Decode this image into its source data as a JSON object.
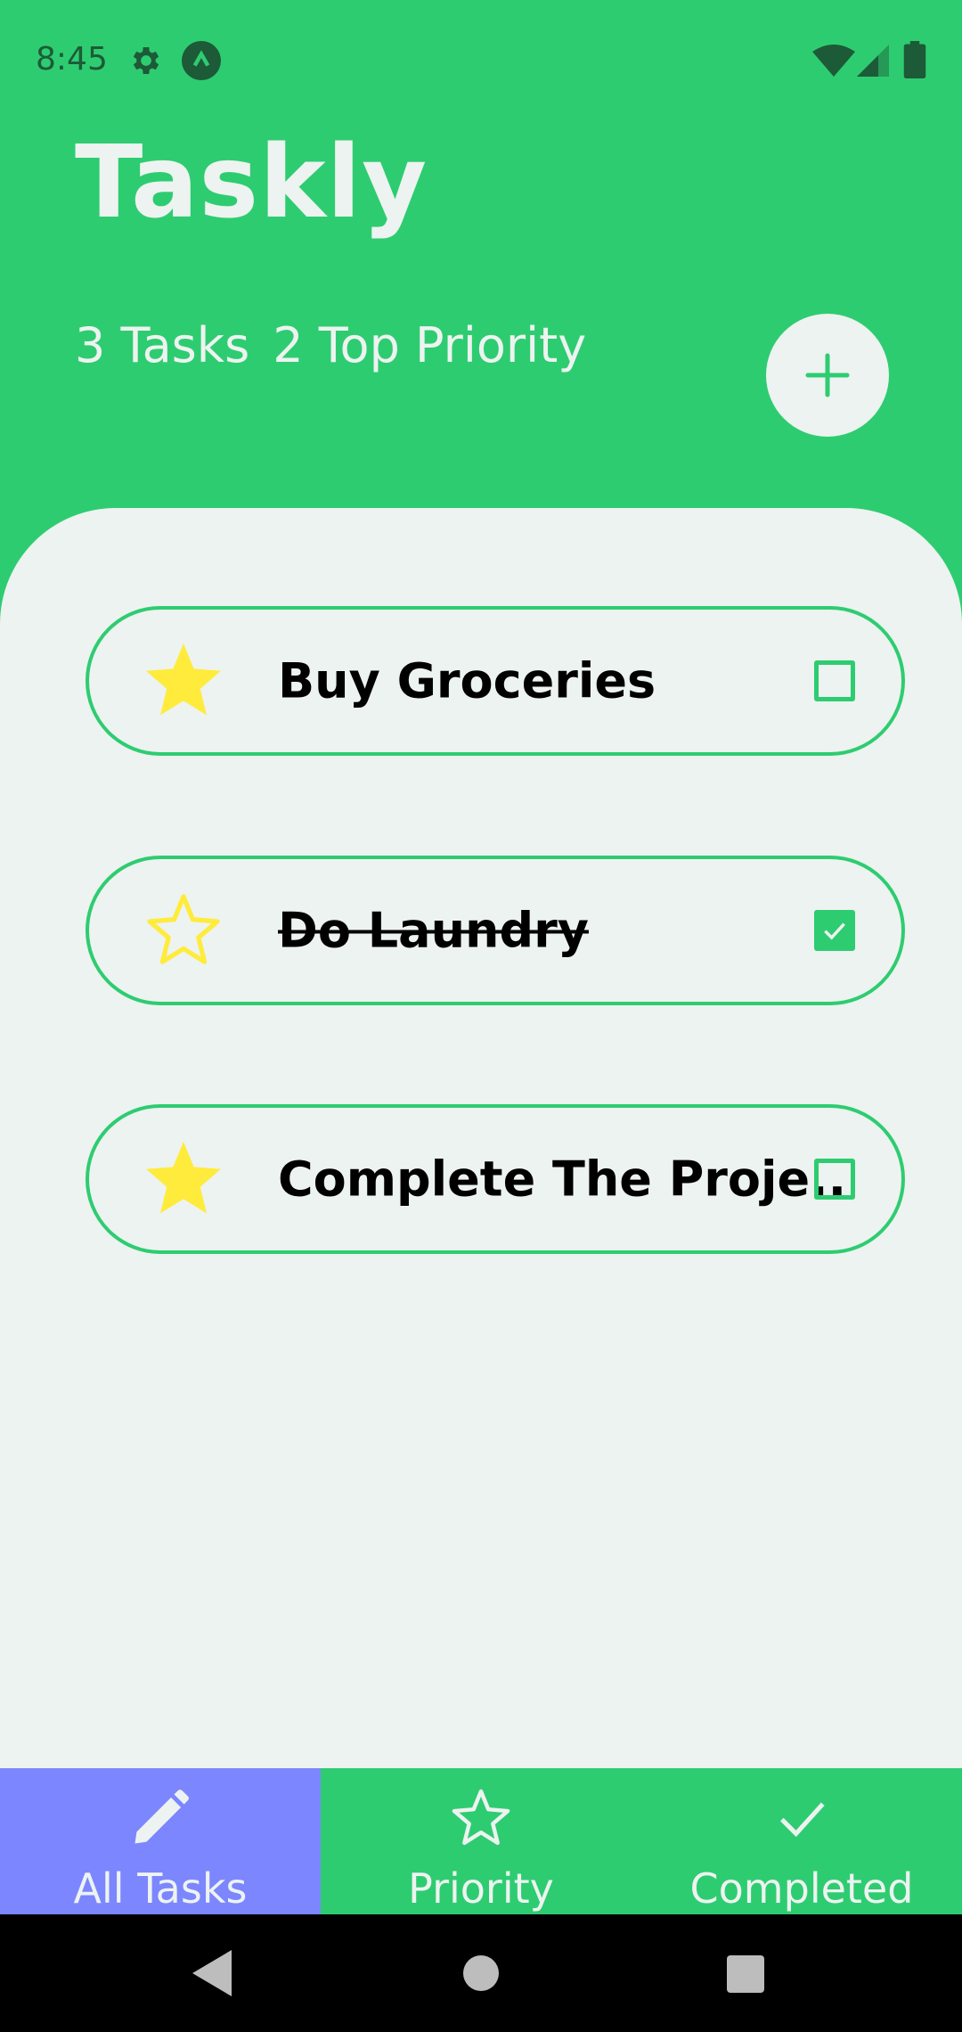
{
  "status_bar": {
    "time": "8:45",
    "icons": [
      "gear-icon",
      "app-notification-icon",
      "wifi-icon",
      "signal-icon",
      "battery-icon"
    ]
  },
  "header": {
    "title": "Taskly",
    "task_count": "3 Tasks",
    "priority_count": "2 Top Priority",
    "add_icon": "plus-icon"
  },
  "tasks": [
    {
      "label": "Buy Groceries",
      "priority": true,
      "completed": false
    },
    {
      "label": "Do Laundry",
      "priority": false,
      "completed": true
    },
    {
      "label": "Complete The Proje..",
      "priority": true,
      "completed": false
    }
  ],
  "bottom_nav": {
    "items": [
      {
        "label": "All Tasks",
        "icon": "pencil-icon",
        "active": true
      },
      {
        "label": "Priority",
        "icon": "star-outline-icon",
        "active": false
      },
      {
        "label": "Completed",
        "icon": "checkmark-icon",
        "active": false
      }
    ]
  },
  "colors": {
    "primary": "#2ECC71",
    "surface": "#EDF3F0",
    "active_tab": "#7B86FF",
    "star": "#FFEB3B"
  }
}
